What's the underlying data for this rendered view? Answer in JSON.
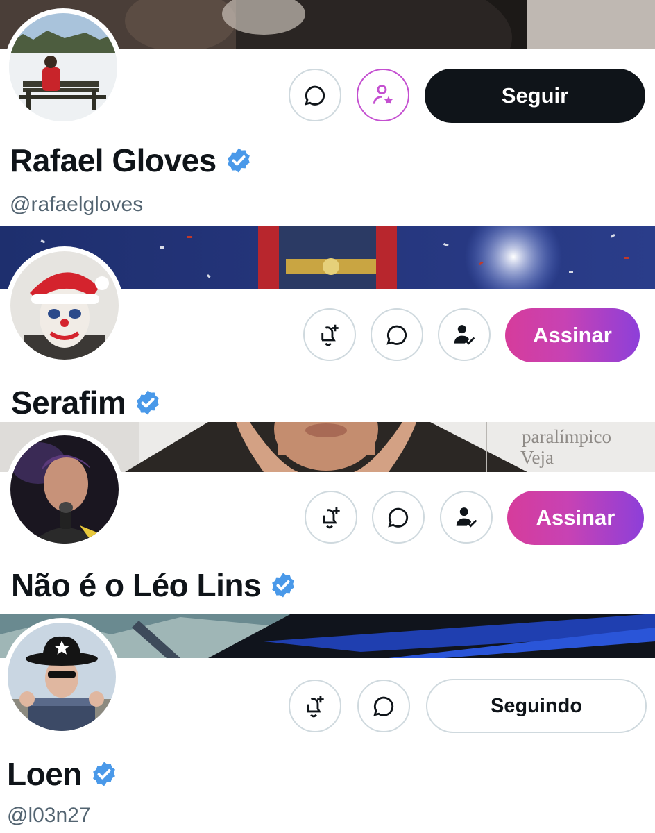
{
  "profiles": [
    {
      "name": "Rafael Gloves",
      "handle": "@rafaelgloves",
      "follow_label": "Seguir",
      "verified": true
    },
    {
      "name": "Serafim",
      "subscribe_label": "Assinar",
      "verified": true
    },
    {
      "name": "Não é o Léo Lins",
      "subscribe_label": "Assinar",
      "verified": true,
      "banner_text": [
        "paralímpico",
        "Veja"
      ]
    },
    {
      "name": "Loen",
      "handle": "@l03n27",
      "following_label": "Seguindo",
      "verified": true
    }
  ],
  "colors": {
    "verified": "#4a99e9",
    "subscribe_gradient_start": "#d63c9b",
    "subscribe_gradient_end": "#8d3fd9",
    "follow_black": "#0f1419",
    "subscription_purple": "#c44fd0",
    "handle_gray": "#536471"
  },
  "icons": [
    "message-icon",
    "subscriptions-icon",
    "notification-add-icon",
    "follows-you-icon",
    "verified-badge-icon"
  ]
}
